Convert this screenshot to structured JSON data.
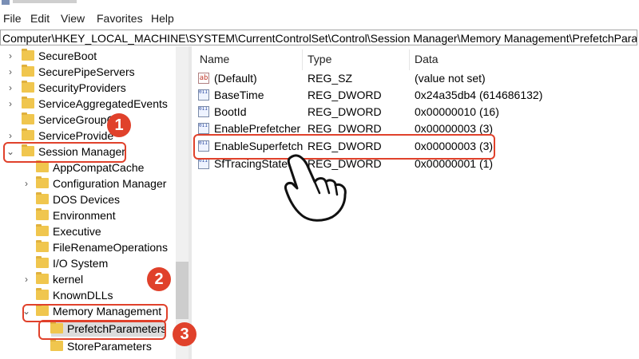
{
  "menu": [
    "File",
    "Edit",
    "View",
    "Favorites",
    "Help"
  ],
  "address": "Computer\\HKEY_LOCAL_MACHINE\\SYSTEM\\CurrentControlSet\\Control\\Session Manager\\Memory Management\\PrefetchParameters",
  "tree": [
    {
      "label": "SecureBoot",
      "expander": "›"
    },
    {
      "label": "SecurePipeServers",
      "expander": "›"
    },
    {
      "label": "SecurityProviders",
      "expander": "›"
    },
    {
      "label": "ServiceAggregatedEvents",
      "expander": "›"
    },
    {
      "label": "ServiceGroupO",
      "expander": ""
    },
    {
      "label": "ServiceProvide",
      "expander": "›"
    },
    {
      "label": "Session Manager",
      "expander": "⌄"
    },
    {
      "label": "AppCompatCache",
      "expander": ""
    },
    {
      "label": "Configuration Manager",
      "expander": "›"
    },
    {
      "label": "DOS Devices",
      "expander": ""
    },
    {
      "label": "Environment",
      "expander": ""
    },
    {
      "label": "Executive",
      "expander": ""
    },
    {
      "label": "FileRenameOperations",
      "expander": ""
    },
    {
      "label": "I/O System",
      "expander": ""
    },
    {
      "label": "kernel",
      "expander": "›"
    },
    {
      "label": "KnownDLLs",
      "expander": ""
    },
    {
      "label": "Memory Management",
      "expander": "⌄"
    },
    {
      "label": "PrefetchParameters",
      "expander": ""
    },
    {
      "label": "StoreParameters",
      "expander": ""
    }
  ],
  "columns": {
    "name": "Name",
    "type": "Type",
    "data": "Data"
  },
  "values": [
    {
      "name": "(Default)",
      "type": "REG_SZ",
      "data": "(value not set)",
      "icon": "ab"
    },
    {
      "name": "BaseTime",
      "type": "REG_DWORD",
      "data": "0x24a35db4 (614686132)",
      "icon": "011 110"
    },
    {
      "name": "BootId",
      "type": "REG_DWORD",
      "data": "0x00000010 (16)",
      "icon": "011 110"
    },
    {
      "name": "EnablePrefetcher",
      "type": "REG_DWORD",
      "data": "0x00000003 (3)",
      "icon": "011 110"
    },
    {
      "name": "EnableSuperfetch",
      "type": "REG_DWORD",
      "data": "0x00000003 (3)",
      "icon": "011 110"
    },
    {
      "name": "SfTracingState",
      "type": "REG_DWORD",
      "data": "0x00000001 (1)",
      "icon": "011 110"
    }
  ],
  "badges": [
    "1",
    "2",
    "3"
  ],
  "colors": {
    "accent": "#e0412b",
    "folder": "#f0c64e"
  }
}
